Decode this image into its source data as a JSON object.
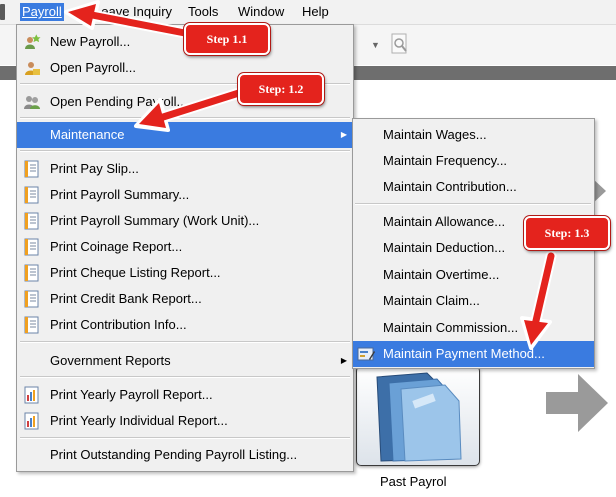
{
  "menubar": {
    "items": [
      "Payroll",
      "Leave",
      "Inquiry",
      "Tools",
      "Window",
      "Help"
    ],
    "active": "Payroll"
  },
  "payroll_menu": {
    "new_payroll": "New Payroll...",
    "open_payroll": "Open Payroll...",
    "open_pending_payroll": "Open Pending Payroll...",
    "maintenance": "Maintenance",
    "print_pay_slip": "Print Pay Slip...",
    "print_payroll_summary": "Print Payroll Summary...",
    "print_payroll_summary_work_unit": "Print Payroll Summary (Work Unit)...",
    "print_coinage_report": "Print Coinage Report...",
    "print_cheque_listing_report": "Print Cheque Listing Report...",
    "print_credit_bank_report": "Print Credit Bank Report...",
    "print_contribution_info": "Print Contribution Info...",
    "government_reports": "Government Reports",
    "print_yearly_payroll_report": "Print Yearly Payroll Report...",
    "print_yearly_individual_report": "Print Yearly Individual Report...",
    "print_outstanding_pending_payroll_listing": "Print Outstanding Pending Payroll Listing..."
  },
  "maintenance_submenu": {
    "maintain_wages": "Maintain Wages...",
    "maintain_frequency": "Maintain Frequency...",
    "maintain_contribution": "Maintain Contribution...",
    "maintain_allowance": "Maintain Allowance...",
    "maintain_deduction": "Maintain Deduction...",
    "maintain_overtime": "Maintain Overtime...",
    "maintain_claim": "Maintain Claim...",
    "maintain_commission": "Maintain Commission...",
    "maintain_payment_method": "Maintain Payment Method..."
  },
  "steps": {
    "step1": "Step 1.1",
    "step2": "Step: 1.2",
    "step3": "Step: 1.3"
  },
  "background": {
    "past_payroll_label": "Past Payrol"
  },
  "colors": {
    "highlight": "#3a7be0",
    "callout": "#e4231d"
  }
}
